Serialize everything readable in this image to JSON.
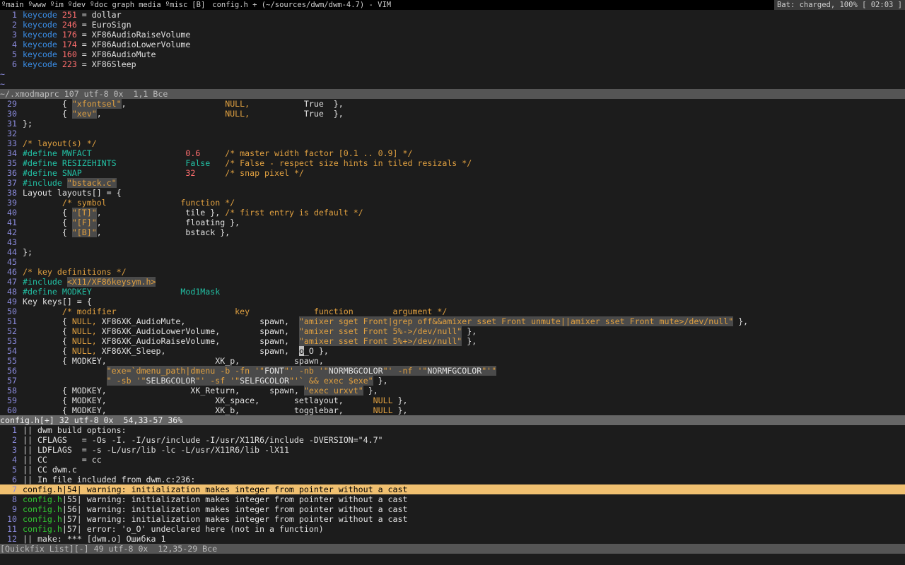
{
  "bar": {
    "tags": [
      "ºmain",
      "ºwww",
      "ºim",
      "ºdev",
      "ºdoc",
      "graph",
      "media",
      "ºmisc",
      "[B]"
    ],
    "title": "config.h + (~/sources/dwm/dwm-4.7) - VIM",
    "status": "Bat: charged, 100% [ 02:03 ]"
  },
  "xmodmap": {
    "lines": [
      {
        "n": "1",
        "code": "251",
        "name": "dollar"
      },
      {
        "n": "2",
        "code": "246",
        "name": "EuroSign"
      },
      {
        "n": "3",
        "code": "176",
        "name": "XF86AudioRaiseVolume"
      },
      {
        "n": "4",
        "code": "174",
        "name": "XF86AudioLowerVolume"
      },
      {
        "n": "5",
        "code": "160",
        "name": "XF86AudioMute"
      },
      {
        "n": "6",
        "code": "223",
        "name": "XF86Sleep"
      }
    ],
    "keyword": "keycode",
    "tilde": "~",
    "statusline": "~/.xmodmaprc 107 utf-8 0x  1,1 Все"
  },
  "config": {
    "t29_str": "\"xfontsel\"",
    "t29_null": "NULL,",
    "t29_true": "True  },",
    "t30_str": "\"xev\"",
    "t30_null": "NULL,",
    "t30_true": "True  },",
    "t31": "};",
    "t33": "/* layout(s) */",
    "t34_def": "#define MWFACT",
    "t34_val": "0.6",
    "t34_cm": "/* master width factor [0.1 .. 0.9] */",
    "t35_def": "#define RESIZEHINTS",
    "t35_val": "False",
    "t35_cm": "/* False - respect size hints in tiled resizals */",
    "t36_def": "#define SNAP",
    "t36_val": "32",
    "t36_cm": "/* snap pixel */",
    "t37_inc": "#include",
    "t37_str": "\"bstack.c\"",
    "t38": "Layout layouts[] = {",
    "t39_cm1": "/* symbol",
    "t39_cm2": "function */",
    "t40_str": "\"[T]\"",
    "t40_fn": "tile },",
    "t40_cm": "/* first entry is default */",
    "t41_str": "\"[F]\"",
    "t41_fn": "floating },",
    "t42_str": "\"[B]\"",
    "t42_fn": "bstack },",
    "t44": "};",
    "t46": "/* key definitions */",
    "t47_inc": "#include",
    "t47_str": "<X11/XF86keysym.h>",
    "t48_def": "#define MODKEY",
    "t48_val": "Mod1Mask",
    "t49": "Key keys[] = {",
    "t50_c1": "/* modifier",
    "t50_c2": "key",
    "t50_c3": "function",
    "t50_c4": "argument */",
    "t51_a": "NULL,",
    "t51_b": "XF86XK_AudioMute,",
    "t51_c": "spawn,",
    "t51_s": "\"amixer sget Front|grep off&&amixer sset Front unmute||amixer sset Front mute>/dev/null\"",
    "t51_e": "},",
    "t52_a": "NULL,",
    "t52_b": "XF86XK_AudioLowerVolume,",
    "t52_c": "spawn,",
    "t52_s": "\"amixer sset Front 5%->/dev/null\"",
    "t52_e": "},",
    "t53_a": "NULL,",
    "t53_b": "XF86XK_AudioRaiseVolume,",
    "t53_c": "spawn,",
    "t53_s": "\"amixer sset Front 5%+>/dev/null\"",
    "t53_e": "},",
    "t54_a": "NULL,",
    "t54_b": "XF86XK_Sleep,",
    "t54_c": "spawn,",
    "t54_cur": "o",
    "t54_s": "_O },",
    "t55_a": "MODKEY,",
    "t55_b": "XK_p,",
    "t55_c": "spawn,",
    "t56_s1": "\"exe=`dmenu_path|dmenu -b -fn '\"",
    "t56_w1": "FONT",
    "t56_s2": "\"' -nb '\"",
    "t56_w2": "NORMBGCOLOR",
    "t56_s3": "\"' -nf '\"",
    "t56_w3": "NORMFGCOLOR",
    "t56_s4": "\"'\"",
    "t57_s1": "\" -sb '\"",
    "t57_w1": "SELBGCOLOR",
    "t57_s2": "\"' -sf '\"",
    "t57_w2": "SELFGCOLOR",
    "t57_s3": "\"'` && exec $exe\"",
    "t57_e": "},",
    "t58_a": "MODKEY,",
    "t58_b": "XK_Return,",
    "t58_c": "spawn,",
    "t58_s": "\"exec urxvt\"",
    "t58_e": "},",
    "t59_a": "MODKEY,",
    "t59_b": "XK_space,",
    "t59_c": "setlayout,",
    "t59_d": "NULL",
    "t60_a": "MODKEY,",
    "t60_b": "XK_b,",
    "t60_c": "togglebar,",
    "t60_d": "NULL",
    "t_end": "},",
    "statusline": "config.h[+] 32 utf-8 0x  54,33-57 36%"
  },
  "quickfix": {
    "lines": [
      {
        "n": "1",
        "file": "",
        "text": "|| dwm build options:"
      },
      {
        "n": "2",
        "file": "",
        "text": "|| CFLAGS   = -Os -I. -I/usr/include -I/usr/X11R6/include -DVERSION=\"4.7\""
      },
      {
        "n": "3",
        "file": "",
        "text": "|| LDFLAGS  = -s -L/usr/lib -lc -L/usr/X11R6/lib -lX11"
      },
      {
        "n": "4",
        "file": "",
        "text": "|| CC       = cc"
      },
      {
        "n": "5",
        "file": "",
        "text": "|| CC dwm.c"
      },
      {
        "n": "6",
        "file": "",
        "text": "|| In file included from dwm.c:236:"
      },
      {
        "n": "7",
        "file": "config.h",
        "text": "|54| warning: initialization makes integer from pointer without a cast"
      },
      {
        "n": "8",
        "file": "config.h",
        "text": "|55| warning: initialization makes integer from pointer without a cast"
      },
      {
        "n": "9",
        "file": "config.h",
        "text": "|56| warning: initialization makes integer from pointer without a cast"
      },
      {
        "n": "10",
        "file": "config.h",
        "text": "|57| warning: initialization makes integer from pointer without a cast"
      },
      {
        "n": "11",
        "file": "config.h",
        "text": "|57| error: 'o_O' undeclared here (not in a function)"
      },
      {
        "n": "12",
        "file": "",
        "text": "|| make: *** [dwm.o] Ошибка 1"
      }
    ],
    "statusline": "[Quickfix List][-] 49 utf-8 0x  12,35-29 Все"
  },
  "colors": {
    "keyword": "#3a8ee8",
    "number": "#ff6e6e",
    "preproc": "#22c0a4",
    "comment": "#e0a040",
    "qf_selected": "#f0c070",
    "qf_file": "#32c832"
  }
}
